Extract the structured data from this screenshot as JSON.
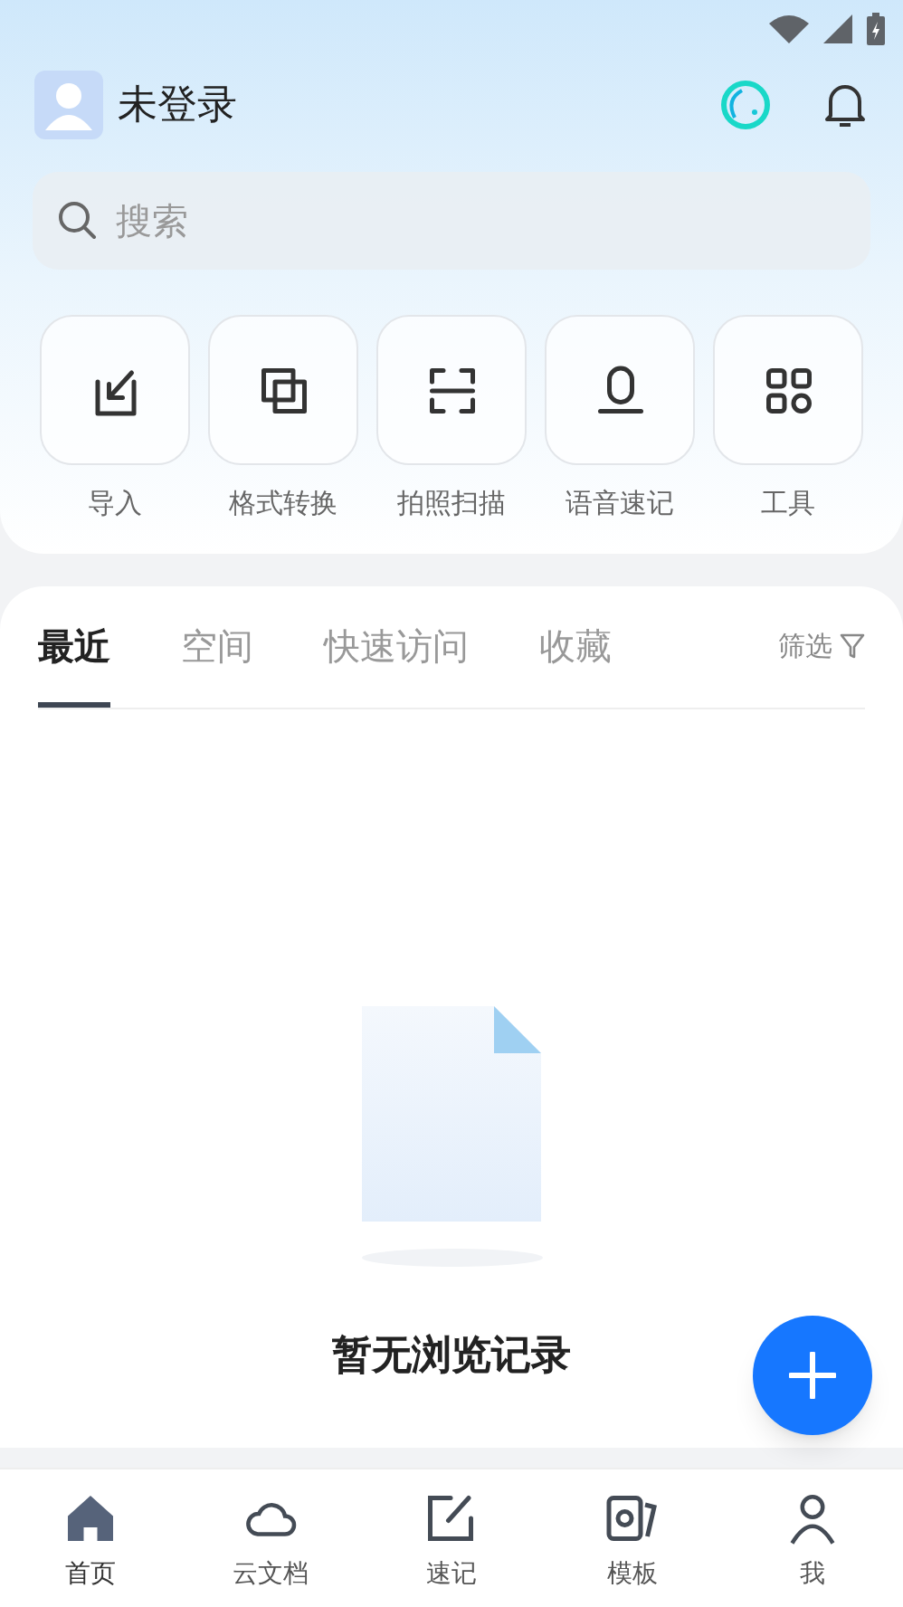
{
  "header": {
    "user_name": "未登录"
  },
  "search": {
    "placeholder": "搜索"
  },
  "tools": [
    {
      "kind": "import",
      "label": "导入"
    },
    {
      "kind": "convert",
      "label": "格式转换"
    },
    {
      "kind": "scan",
      "label": "拍照扫描"
    },
    {
      "kind": "voice",
      "label": "语音速记"
    },
    {
      "kind": "tools",
      "label": "工具"
    }
  ],
  "tabs": [
    {
      "label": "最近",
      "selected": true
    },
    {
      "label": "空间",
      "selected": false
    },
    {
      "label": "快速访问",
      "selected": false
    },
    {
      "label": "收藏",
      "selected": false
    }
  ],
  "filter": {
    "label": "筛选"
  },
  "empty_state": {
    "message": "暂无浏览记录"
  },
  "bottom_nav": [
    {
      "kind": "home",
      "label": "首页",
      "selected": true
    },
    {
      "kind": "cloud",
      "label": "云文档",
      "selected": false
    },
    {
      "kind": "note",
      "label": "速记",
      "selected": false
    },
    {
      "kind": "template",
      "label": "模板",
      "selected": false
    },
    {
      "kind": "me",
      "label": "我",
      "selected": false
    }
  ]
}
